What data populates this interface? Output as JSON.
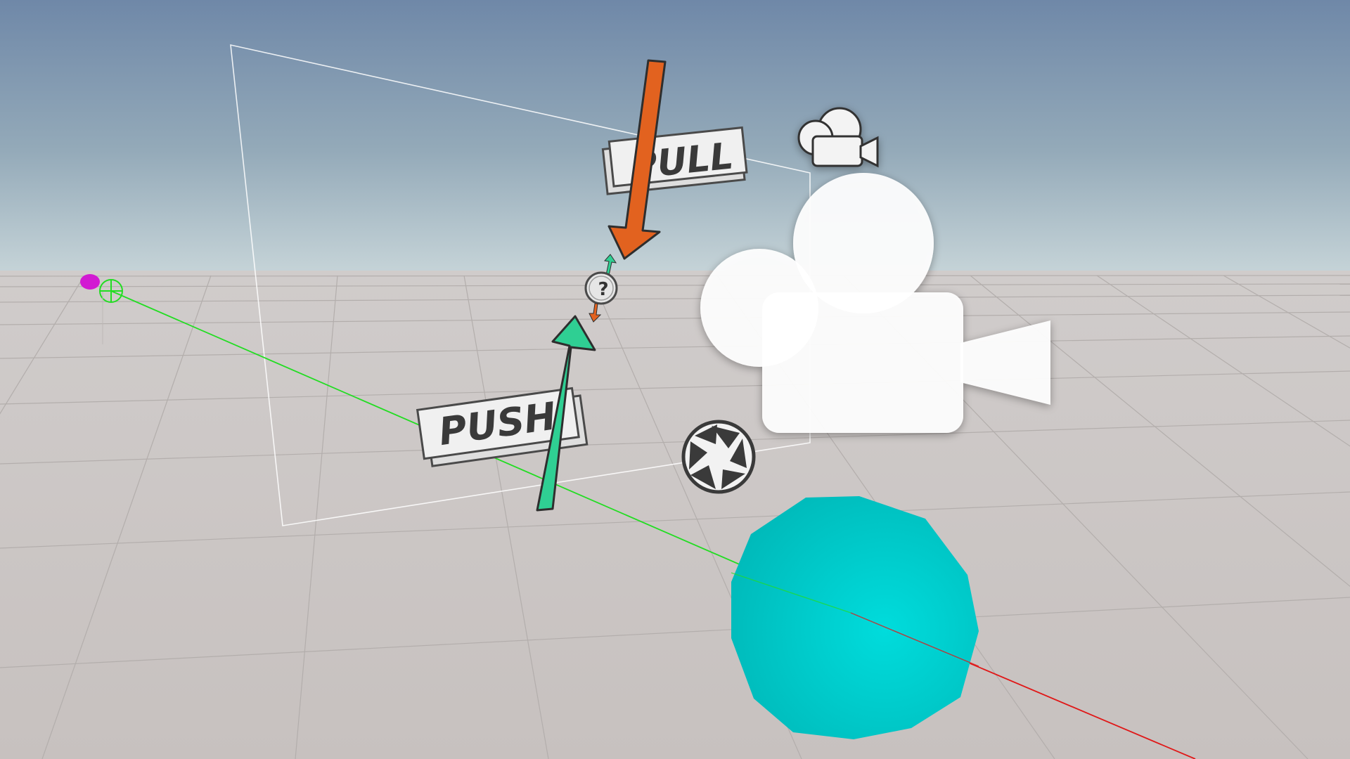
{
  "scene": {
    "view": "scene-view-3d",
    "sky_top_color": "#6f88a8",
    "sky_horizon_color": "#c3d2d8",
    "ground_color": "#c9c4c2",
    "grid_color": "#b2adab"
  },
  "gizmos": {
    "pull": {
      "label": "PULL",
      "arrow_color": "#e2621f"
    },
    "push": {
      "label": "PUSH",
      "arrow_color": "#2fcf93"
    },
    "unknown": {
      "label": "?",
      "icon": "question-mark-icon"
    },
    "camera_small": {
      "icon": "camera-icon"
    },
    "camera_large": {
      "icon": "camera-icon"
    },
    "aperture": {
      "icon": "aperture-icon"
    },
    "target": {
      "icon": "crosshair-icon",
      "color": "#22dd22"
    },
    "origin": {
      "icon": "sphere-icon",
      "color": "#d21ad2"
    }
  },
  "objects": {
    "sphere": {
      "color": "#00cccc"
    },
    "green_line": {
      "color": "#22dd22"
    },
    "red_line": {
      "color": "#e01818"
    },
    "frustum": {
      "color": "#ffffff"
    }
  }
}
